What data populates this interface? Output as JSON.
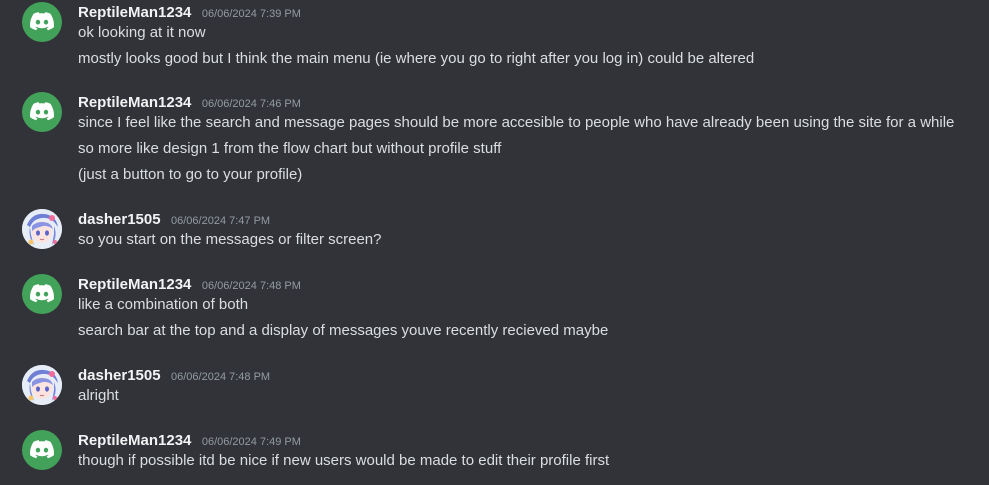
{
  "messages": [
    {
      "username": "ReptileMan1234",
      "timestamp": "06/06/2024 7:39 PM",
      "avatar": "discord-logo-icon",
      "lines": [
        "ok looking at it now",
        "mostly looks good but I think the main menu (ie where you go to right after you log in) could be altered"
      ]
    },
    {
      "username": "ReptileMan1234",
      "timestamp": "06/06/2024 7:46 PM",
      "avatar": "discord-logo-icon",
      "lines": [
        "since I feel like the search and message pages should be more accesible to people who have already been using the site for a while",
        "so more like design 1 from the flow chart but without profile stuff",
        "(just a button to go to your profile)"
      ]
    },
    {
      "username": "dasher1505",
      "timestamp": "06/06/2024 7:47 PM",
      "avatar": "anime-avatar-icon",
      "lines": [
        "so you start on the messages or filter screen?"
      ]
    },
    {
      "username": "ReptileMan1234",
      "timestamp": "06/06/2024 7:48 PM",
      "avatar": "discord-logo-icon",
      "lines": [
        "like a combination of both",
        "search bar at the top and a display of messages youve recently recieved maybe"
      ]
    },
    {
      "username": "dasher1505",
      "timestamp": "06/06/2024 7:48 PM",
      "avatar": "anime-avatar-icon",
      "lines": [
        "alright"
      ]
    },
    {
      "username": "ReptileMan1234",
      "timestamp": "06/06/2024 7:49 PM",
      "avatar": "discord-logo-icon",
      "lines": [
        "though if possible itd be nice if new users would be made to edit their profile first"
      ]
    }
  ],
  "colors": {
    "background": "#313338",
    "discord_avatar": "#43a25a",
    "username": "#f2f3f5",
    "timestamp": "#949ba4",
    "text": "#dbdee1"
  }
}
